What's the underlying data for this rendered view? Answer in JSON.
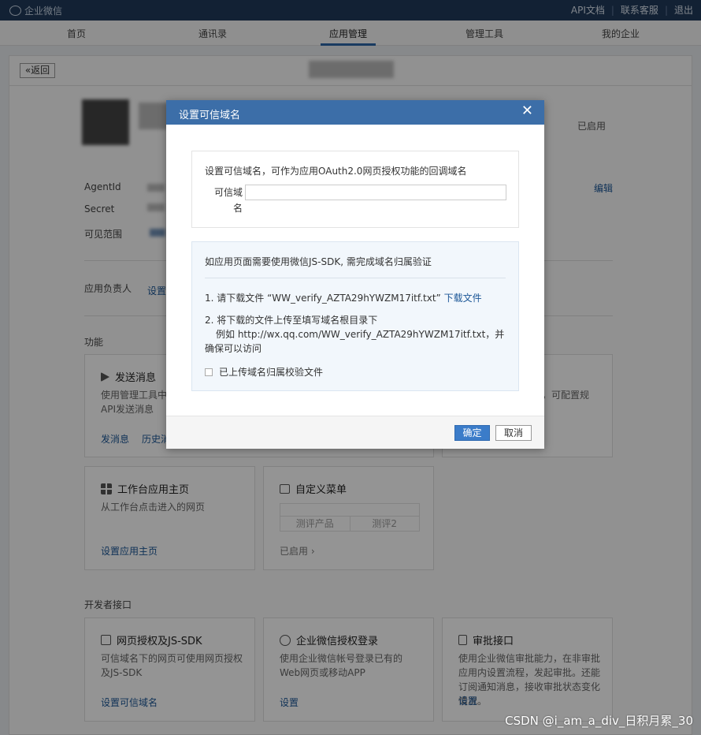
{
  "topbar": {
    "logo_text": "企业微信",
    "links": [
      "API文档",
      "联系客服",
      "退出"
    ],
    "separator": "|"
  },
  "nav": {
    "items": [
      "首页",
      "通讯录",
      "应用管理",
      "管理工具",
      "我的企业"
    ],
    "active": "应用管理"
  },
  "page": {
    "back_label": "«返回",
    "status_enabled": "已启用",
    "fields": {
      "agentid_label": "AgentId",
      "secret_label": "Secret",
      "visible_label": "可见范围",
      "edit_link": "编辑",
      "owner_label": "应用负责人",
      "owner_link": "设置"
    },
    "section_functions": "功能",
    "section_dev": "开发者接口",
    "cards": {
      "send_message": {
        "title": "发送消息",
        "desc": "使用管理工具中\nAPI发送消息",
        "links": [
          "发消息",
          "历史消"
        ]
      },
      "right_partial": {
        "desc": "，可配置规"
      },
      "workbench": {
        "title": "工作台应用主页",
        "desc": "从工作台点击进入的网页",
        "link": "设置应用主页"
      },
      "custom_menu": {
        "title": "自定义菜单",
        "menu_items": [
          "测评产品",
          "测评2"
        ],
        "status": "已启用 ›"
      },
      "oauth_jssdk": {
        "title": "网页授权及JS-SDK",
        "desc": "可信域名下的网页可使用网页授权及JS-SDK",
        "link": "设置可信域名"
      },
      "wecom_login": {
        "title": "企业微信授权登录",
        "desc": "使用企业微信帐号登录已有的Web网页或移动APP",
        "link": "设置"
      },
      "approval": {
        "title": "审批接口",
        "desc": "使用企业微信审批能力，在非审批应用内设置流程，发起审批。还能订阅通知消息，接收审批状态变化情况。",
        "link": "设置"
      }
    }
  },
  "modal": {
    "title": "设置可信域名",
    "close_icon": "close-icon",
    "desc": "设置可信域名，可作为应用OAuth2.0网页授权功能的回调域名",
    "field_label": "可信域名",
    "field_value": "",
    "verify_intro": "如应用页面需要使用微信JS-SDK, 需完成域名归属验证",
    "step1_text": "1. 请下载文件 “WW_verify_AZTA29hYWZM17itf.txt”",
    "step1_link": "下载文件",
    "step2_text": "2. 将下载的文件上传至填写域名根目录下",
    "step2_example": "例如 http://wx.qq.com/WW_verify_AZTA29hYWZM17itf.txt，并确保可以访问",
    "checkbox_label": "已上传域名归属校验文件",
    "ok_label": "确定",
    "cancel_label": "取消"
  },
  "watermark": "CSDN @i_am_a_div_日积月累_30",
  "colors": {
    "topbar": "#1f3a5a",
    "modal_header": "#3c6ea8",
    "link": "#1c5797",
    "primary_button": "#3b7cc9"
  }
}
